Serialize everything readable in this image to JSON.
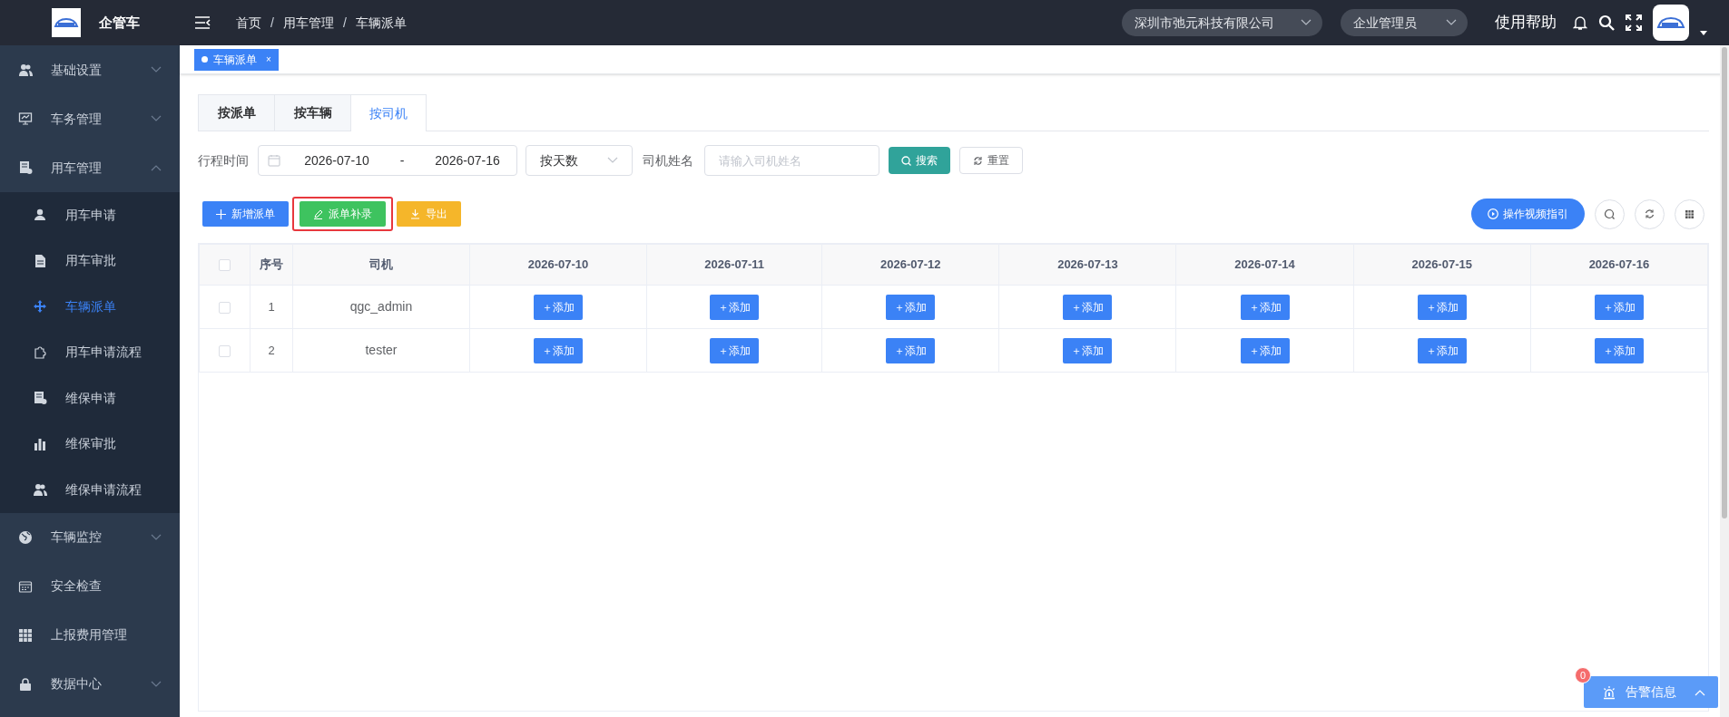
{
  "header": {
    "logo_text": "企管车",
    "breadcrumb": [
      {
        "label": "首页",
        "kind": "link"
      },
      {
        "label": "/",
        "kind": "separator"
      },
      {
        "label": "用车管理",
        "kind": "link"
      },
      {
        "label": "/",
        "kind": "separator"
      },
      {
        "label": "车辆派单",
        "kind": "link"
      }
    ],
    "company": "深圳市弛元科技有限公司",
    "role": "企业管理员",
    "help": "使用帮助"
  },
  "sidebar": {
    "items": [
      {
        "label": "基础设置",
        "expanded": false,
        "has_arrow": true
      },
      {
        "label": "车务管理",
        "expanded": false,
        "has_arrow": true
      },
      {
        "label": "用车管理",
        "expanded": true,
        "has_arrow": true,
        "children": [
          {
            "label": "用车申请",
            "selected": false
          },
          {
            "label": "用车审批",
            "selected": false
          },
          {
            "label": "车辆派单",
            "selected": true
          },
          {
            "label": "用车申请流程",
            "selected": false
          },
          {
            "label": "维保申请",
            "selected": false
          },
          {
            "label": "维保审批",
            "selected": false
          },
          {
            "label": "维保申请流程",
            "selected": false
          }
        ]
      },
      {
        "label": "车辆监控",
        "expanded": false,
        "has_arrow": true
      },
      {
        "label": "安全检查",
        "expanded": false,
        "has_arrow": false
      },
      {
        "label": "上报费用管理",
        "expanded": false,
        "has_arrow": false
      },
      {
        "label": "数据中心",
        "expanded": false,
        "has_arrow": true
      }
    ]
  },
  "page_tabs": [
    {
      "label": "车辆派单",
      "selected": true,
      "close": "×"
    }
  ],
  "view_tabs": [
    {
      "label": "按派单",
      "selected": false
    },
    {
      "label": "按车辆",
      "selected": false
    },
    {
      "label": "按司机",
      "selected": true
    }
  ],
  "filters": {
    "trip_label": "行程时间",
    "start": "2026-07-10",
    "separator": "-",
    "end": "2026-07-16",
    "mode": "按天数",
    "driver_label": "司机姓名",
    "driver_placeholder": "请输入司机姓名",
    "search": "搜索",
    "reset": "重置"
  },
  "actions": [
    {
      "label": "新增派单",
      "kind": "add",
      "highlighted": false
    },
    {
      "label": "派单补录",
      "kind": "edit",
      "highlighted": true
    },
    {
      "label": "导出",
      "kind": "export",
      "highlighted": false
    }
  ],
  "video_guide": "操作视频指引",
  "table": {
    "all_checked": false,
    "columns": [
      "序号",
      "司机",
      "2026-07-10",
      "2026-07-11",
      "2026-07-12",
      "2026-07-13",
      "2026-07-14",
      "2026-07-15",
      "2026-07-16"
    ],
    "rows": [
      {
        "checked": false,
        "cells": [
          "1",
          "qgc_admin",
          "＋添加",
          "＋添加",
          "＋添加",
          "＋添加",
          "＋添加",
          "＋添加",
          "＋添加"
        ]
      },
      {
        "checked": false,
        "cells": [
          "2",
          "tester",
          "＋添加",
          "＋添加",
          "＋添加",
          "＋添加",
          "＋添加",
          "＋添加",
          "＋添加"
        ]
      }
    ]
  },
  "alert": {
    "count": "0",
    "label": "告警信息"
  }
}
